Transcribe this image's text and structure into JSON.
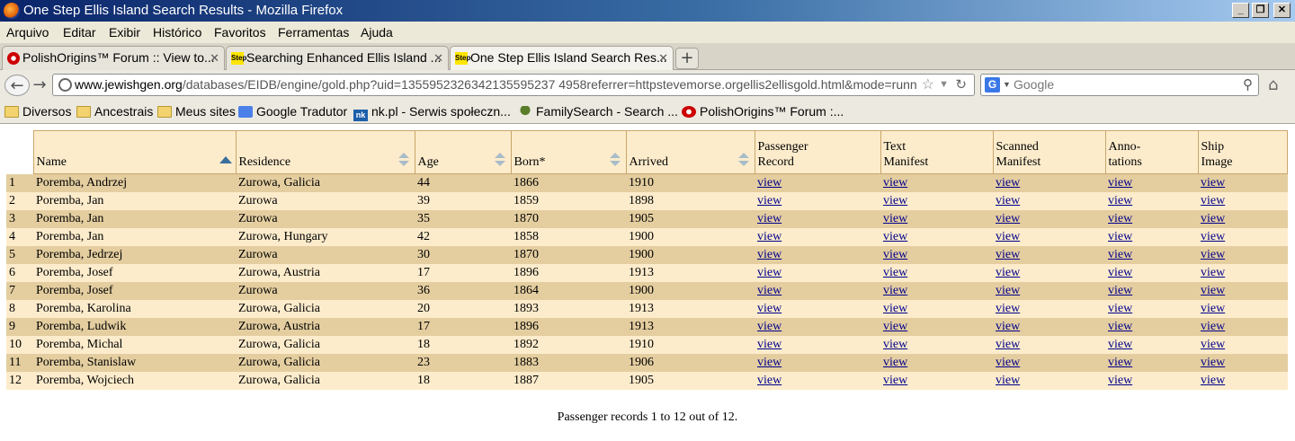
{
  "window": {
    "title": "One Step Ellis Island Search Results - Mozilla Firefox"
  },
  "menu": [
    "Arquivo",
    "Editar",
    "Exibir",
    "Histórico",
    "Favoritos",
    "Ferramentas",
    "Ajuda"
  ],
  "tabs": [
    {
      "label": "PolishOrigins™ Forum :: View to...",
      "icon": "polishorigins-icon"
    },
    {
      "label": "Searching Enhanced Ellis Island ...",
      "icon": "step-icon"
    },
    {
      "label": "One Step Ellis Island Search Res...",
      "icon": "step-icon",
      "active": true
    }
  ],
  "address": {
    "domain": "www.jewishgen.org",
    "path": "/databases/EIDB/engine/gold.php?uid=1355952326342135595237 4958referrer=httpstevemorse.orgellis2ellisgold.html&mode=runn"
  },
  "search": {
    "placeholder": "Google",
    "engine": "G"
  },
  "bookmarks": [
    {
      "label": "Diversos",
      "icon": "folder"
    },
    {
      "label": "Ancestrais",
      "icon": "folder"
    },
    {
      "label": "Meus sites",
      "icon": "folder"
    },
    {
      "label": "Google Tradutor",
      "icon": "google-translate"
    },
    {
      "label": "nk.pl - Serwis społeczn...",
      "icon": "nk"
    },
    {
      "label": "FamilySearch - Search ...",
      "icon": "familysearch"
    },
    {
      "label": "PolishOrigins™ Forum :...",
      "icon": "polishorigins"
    }
  ],
  "table": {
    "headers": {
      "name": "Name",
      "residence": "Residence",
      "age": "Age",
      "born": "Born*",
      "arrived": "Arrived",
      "passenger1": "Passenger",
      "passenger2": "Record",
      "text1": "Text",
      "text2": "Manifest",
      "scanned1": "Scanned",
      "scanned2": "Manifest",
      "anno1": "Anno-",
      "anno2": "tations",
      "ship1": "Ship",
      "ship2": "Image"
    },
    "link_label": "view",
    "rows": [
      {
        "n": "1",
        "name": "Poremba, Andrzej",
        "residence": "Zurowa, Galicia",
        "age": "44",
        "born": "1866",
        "arrived": "1910"
      },
      {
        "n": "2",
        "name": "Poremba, Jan",
        "residence": "Zurowa",
        "age": "39",
        "born": "1859",
        "arrived": "1898"
      },
      {
        "n": "3",
        "name": "Poremba, Jan",
        "residence": "Zurowa",
        "age": "35",
        "born": "1870",
        "arrived": "1905"
      },
      {
        "n": "4",
        "name": "Poremba, Jan",
        "residence": "Zurowa, Hungary",
        "age": "42",
        "born": "1858",
        "arrived": "1900"
      },
      {
        "n": "5",
        "name": "Poremba, Jedrzej",
        "residence": "Zurowa",
        "age": "30",
        "born": "1870",
        "arrived": "1900"
      },
      {
        "n": "6",
        "name": "Poremba, Josef",
        "residence": "Zurowa, Austria",
        "age": "17",
        "born": "1896",
        "arrived": "1913"
      },
      {
        "n": "7",
        "name": "Poremba, Josef",
        "residence": "Zurowa",
        "age": "36",
        "born": "1864",
        "arrived": "1900"
      },
      {
        "n": "8",
        "name": "Poremba, Karolina",
        "residence": "Zurowa, Galicia",
        "age": "20",
        "born": "1893",
        "arrived": "1913"
      },
      {
        "n": "9",
        "name": "Poremba, Ludwik",
        "residence": "Zurowa, Austria",
        "age": "17",
        "born": "1896",
        "arrived": "1913"
      },
      {
        "n": "10",
        "name": "Poremba, Michal",
        "residence": "Zurowa, Galicia",
        "age": "18",
        "born": "1892",
        "arrived": "1910"
      },
      {
        "n": "11",
        "name": "Poremba, Stanislaw",
        "residence": "Zurowa, Galicia",
        "age": "23",
        "born": "1883",
        "arrived": "1906"
      },
      {
        "n": "12",
        "name": "Poremba, Wojciech",
        "residence": "Zurowa, Galicia",
        "age": "18",
        "born": "1887",
        "arrived": "1905"
      }
    ]
  },
  "footer": "Passenger records 1 to 12 out of 12."
}
